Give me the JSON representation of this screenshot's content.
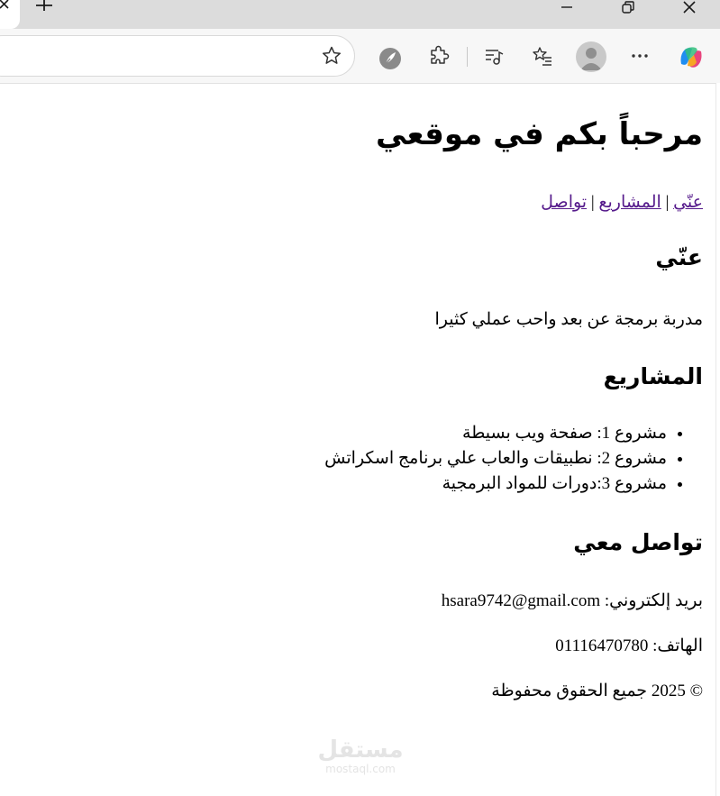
{
  "browser": {
    "colors": {
      "titlebar": "#dcdcdc",
      "toolbar": "#f7f7f7",
      "link": "#551a8b"
    }
  },
  "page": {
    "title": "مرحباً بكم في موقعي",
    "nav": {
      "about": "عنّي",
      "projects": "المشاريع",
      "contact": "تواصل",
      "separator": "|"
    },
    "about": {
      "heading": "عنّي",
      "text": "مدربة برمجة عن بعد واحب عملي كثيرا"
    },
    "projects": {
      "heading": "المشاريع",
      "items": [
        "مشروع 1: صفحة ويب بسيطة",
        "مشروع 2: نطبيقات والعاب علي برنامج اسكراتش",
        "مشروع 3:دورات للمواد البرمجية"
      ]
    },
    "contact": {
      "heading": "تواصل معي",
      "email": "بريد إلكتروني: hsara9742@gmail.com",
      "phone": "الهاتف: 01116470780",
      "copyright": "© 2025 جميع الحقوق محفوظة"
    }
  },
  "watermark": {
    "brand": "مستقل",
    "site": "mostaql.com"
  }
}
